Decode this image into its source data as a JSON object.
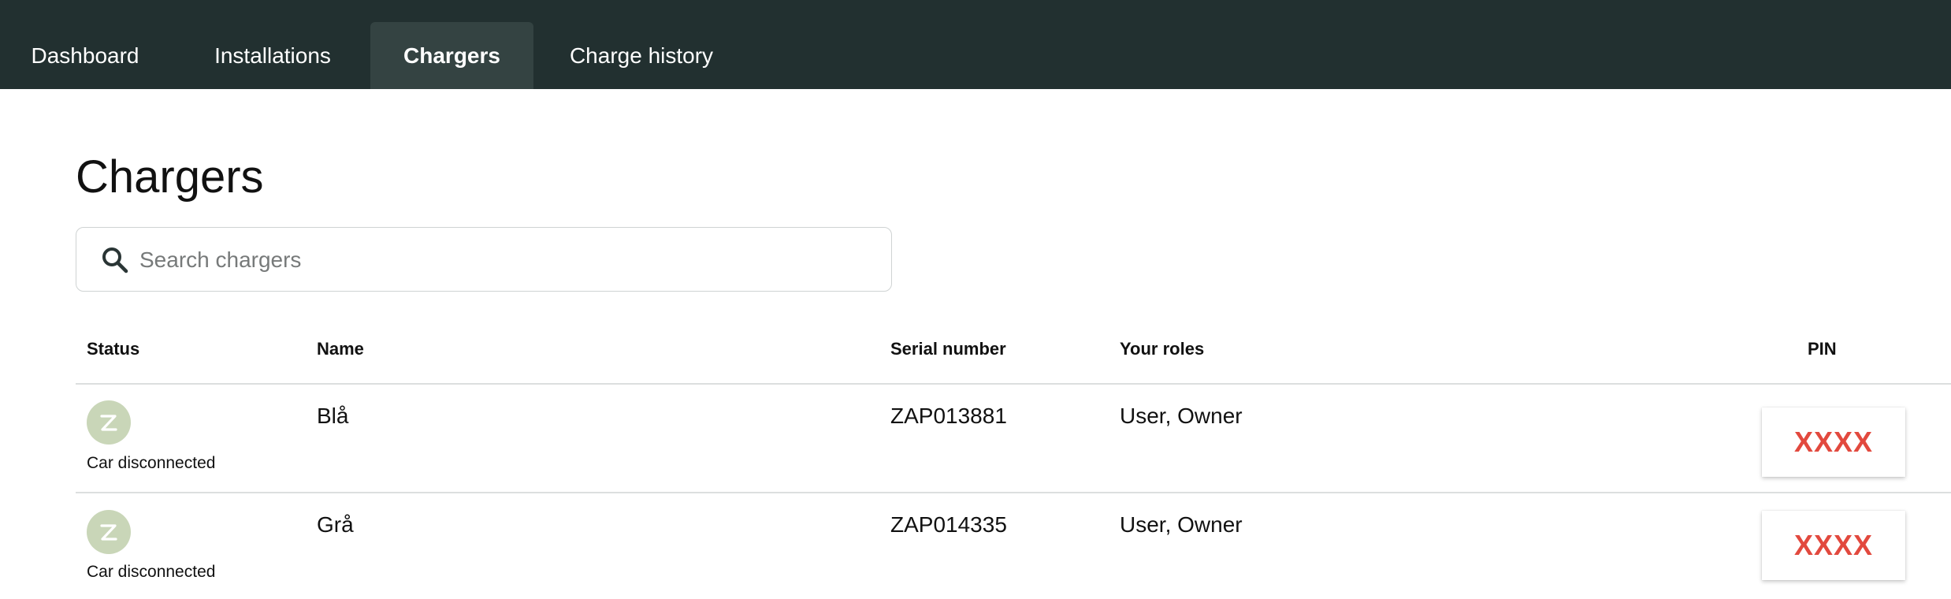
{
  "nav": {
    "tabs": [
      {
        "label": "Dashboard",
        "active": false
      },
      {
        "label": "Installations",
        "active": false
      },
      {
        "label": "Chargers",
        "active": true
      },
      {
        "label": "Charge history",
        "active": false
      }
    ]
  },
  "page": {
    "title": "Chargers"
  },
  "search": {
    "placeholder": "Search chargers",
    "value": ""
  },
  "table": {
    "columns": {
      "status": "Status",
      "name": "Name",
      "serial": "Serial number",
      "roles": "Your roles",
      "pin": "PIN"
    },
    "rows": [
      {
        "status": "Car disconnected",
        "status_icon": "zaptec-logo-icon",
        "name": "Blå",
        "serial": "ZAP013881",
        "roles": "User, Owner",
        "pin": "XXXX"
      },
      {
        "status": "Car disconnected",
        "status_icon": "zaptec-logo-icon",
        "name": "Grå",
        "serial": "ZAP014335",
        "roles": "User, Owner",
        "pin": "XXXX"
      }
    ]
  },
  "colors": {
    "nav_bg": "#223030",
    "nav_active_bg": "#344342",
    "pin_text": "#e2493e",
    "status_avatar_bg": "#c9d6b8"
  }
}
